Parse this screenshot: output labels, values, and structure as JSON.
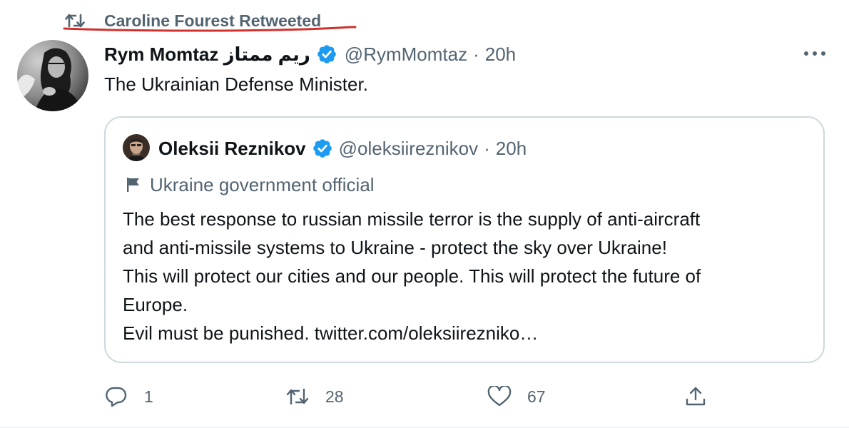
{
  "retweet": {
    "label": "Caroline Fourest Retweeted",
    "icon": "retweet-icon",
    "annotation_color": "#d0312d"
  },
  "tweet": {
    "author_name": "Rym Momtaz ريم ممتاز",
    "handle": "@RymMomtaz",
    "separator": "·",
    "time": "20h",
    "text": "The Ukrainian Defense Minister.",
    "verified": true,
    "more_icon": "more-icon"
  },
  "quote": {
    "author_name": "Oleksii Reznikov",
    "handle": "@oleksiireznikov",
    "separator": "·",
    "time": "20h",
    "verified": true,
    "label": "Ukraine government official",
    "label_icon": "flag-icon",
    "body_lines": [
      "The best response to russian missile terror is the supply of anti-aircraft",
      "and anti-missile systems to Ukraine - protect the sky over Ukraine!",
      "This will protect our cities and our people. This will protect the future of",
      "Europe.",
      "Evil must be punished. twitter.com/oleksiirezniko…"
    ]
  },
  "actions": {
    "reply_count": "1",
    "retweet_count": "28",
    "like_count": "67",
    "share_count": ""
  },
  "colors": {
    "text_primary": "#0f1419",
    "text_secondary": "#536471",
    "verified_blue": "#1d9bf0",
    "border": "#cfd9de"
  }
}
